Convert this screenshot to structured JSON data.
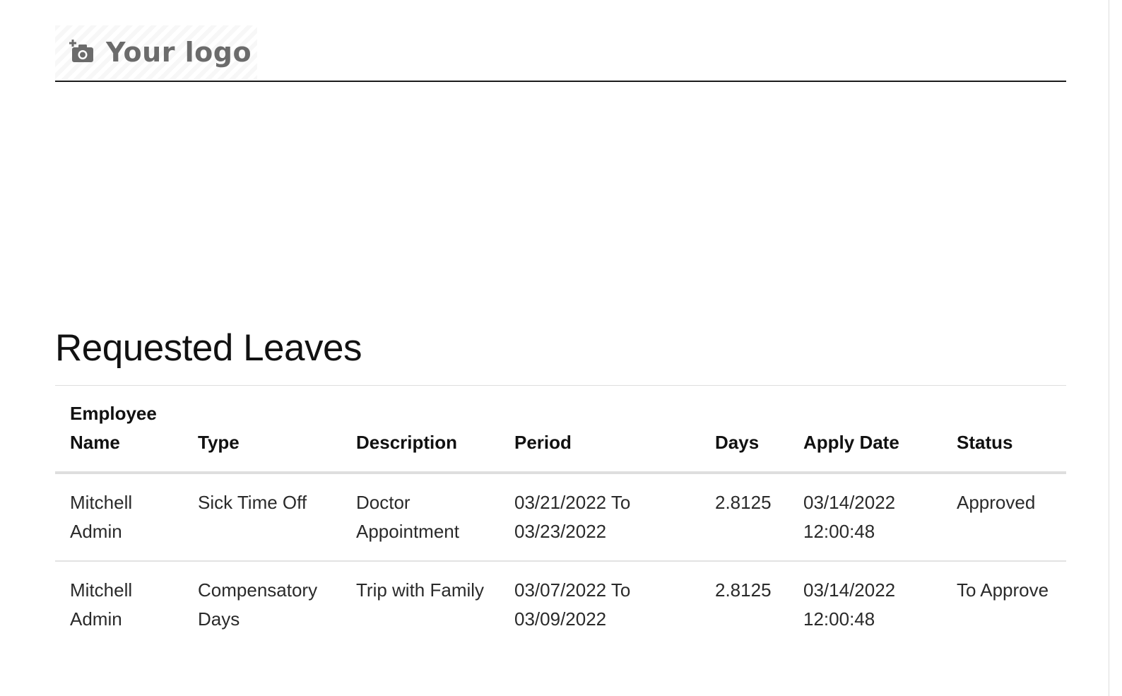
{
  "header": {
    "logo_text": "Your logo",
    "logo_icon": "camera-plus-icon"
  },
  "report": {
    "title": "Requested Leaves",
    "columns": [
      "Employee Name",
      "Type",
      "Description",
      "Period",
      "Days",
      "Apply Date",
      "Status"
    ],
    "rows": [
      {
        "employee_name": "Mitchell Admin",
        "type": "Sick Time Off",
        "description": "Doctor Appointment",
        "period": "03/21/2022 To 03/23/2022",
        "days": "2.8125",
        "apply_date": "03/14/2022 12:00:48",
        "status": "Approved"
      },
      {
        "employee_name": "Mitchell Admin",
        "type": "Compensatory Days",
        "description": "Trip with Family",
        "period": "03/07/2022 To 03/09/2022",
        "days": "2.8125",
        "apply_date": "03/14/2022 12:00:48",
        "status": "To Approve"
      }
    ]
  },
  "colors": {
    "text": "#1c1c1c",
    "logo_gray": "#6b6b6b",
    "rule": "#dedede"
  }
}
